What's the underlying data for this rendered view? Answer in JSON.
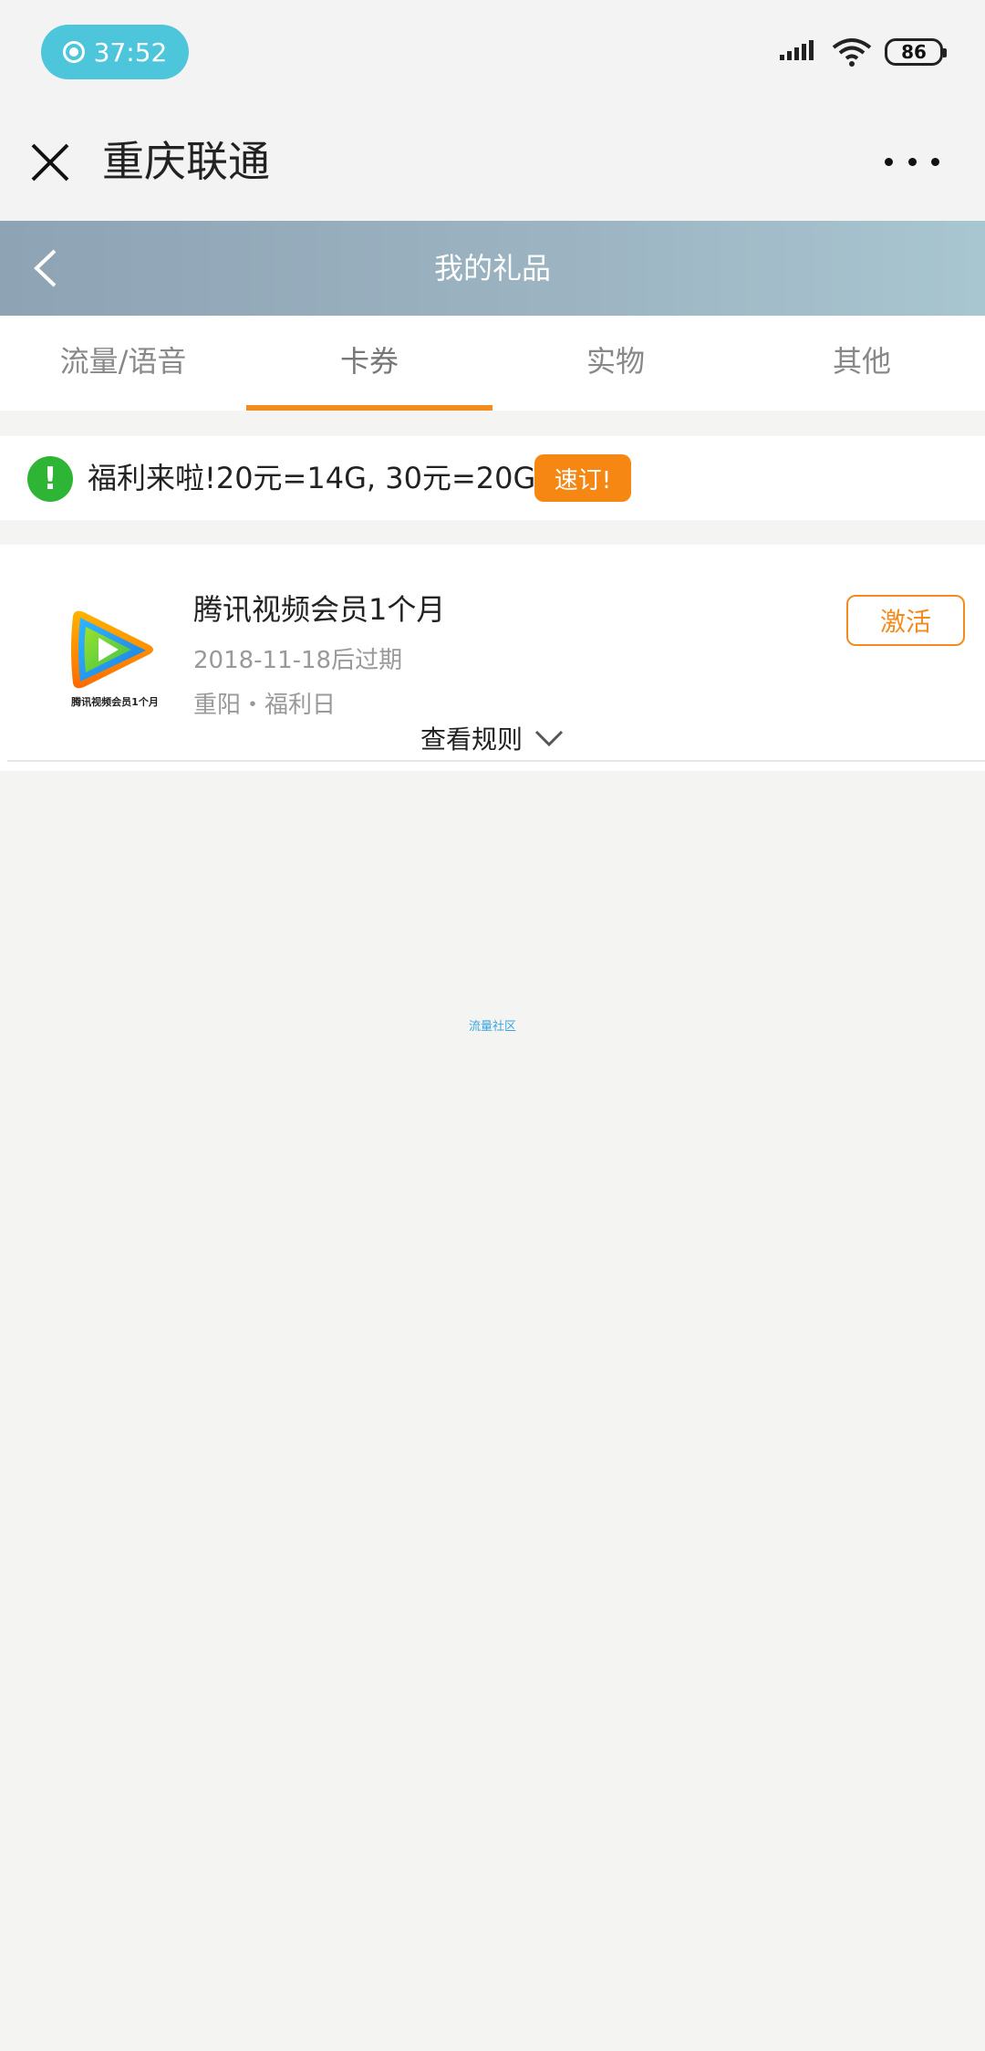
{
  "status_bar": {
    "time": "37:52",
    "battery": "86"
  },
  "app_bar": {
    "title": "重庆联通"
  },
  "header": {
    "title": "我的礼品"
  },
  "tabs": [
    {
      "label": "流量/语音"
    },
    {
      "label": "卡券"
    },
    {
      "label": "实物"
    },
    {
      "label": "其他"
    }
  ],
  "promo": {
    "icon": "!",
    "text": "福利来啦!20元=14G, 30元=20G!",
    "button": "速订!"
  },
  "coupons": [
    {
      "thumb_caption": "腾讯视频会员1个月",
      "title": "腾讯视频会员1个月",
      "expiry": "2018-11-18后过期",
      "source": "重阳・福利日",
      "action": "激活",
      "rules": "查看规则"
    }
  ],
  "footer": {
    "link": "流量社区"
  },
  "colors": {
    "accent": "#f38b1e",
    "promo_green": "#2fb535",
    "header_gradient": [
      "#8ea3b4",
      "#a8c6d0"
    ],
    "rec_pill": "#4dc6dc"
  }
}
